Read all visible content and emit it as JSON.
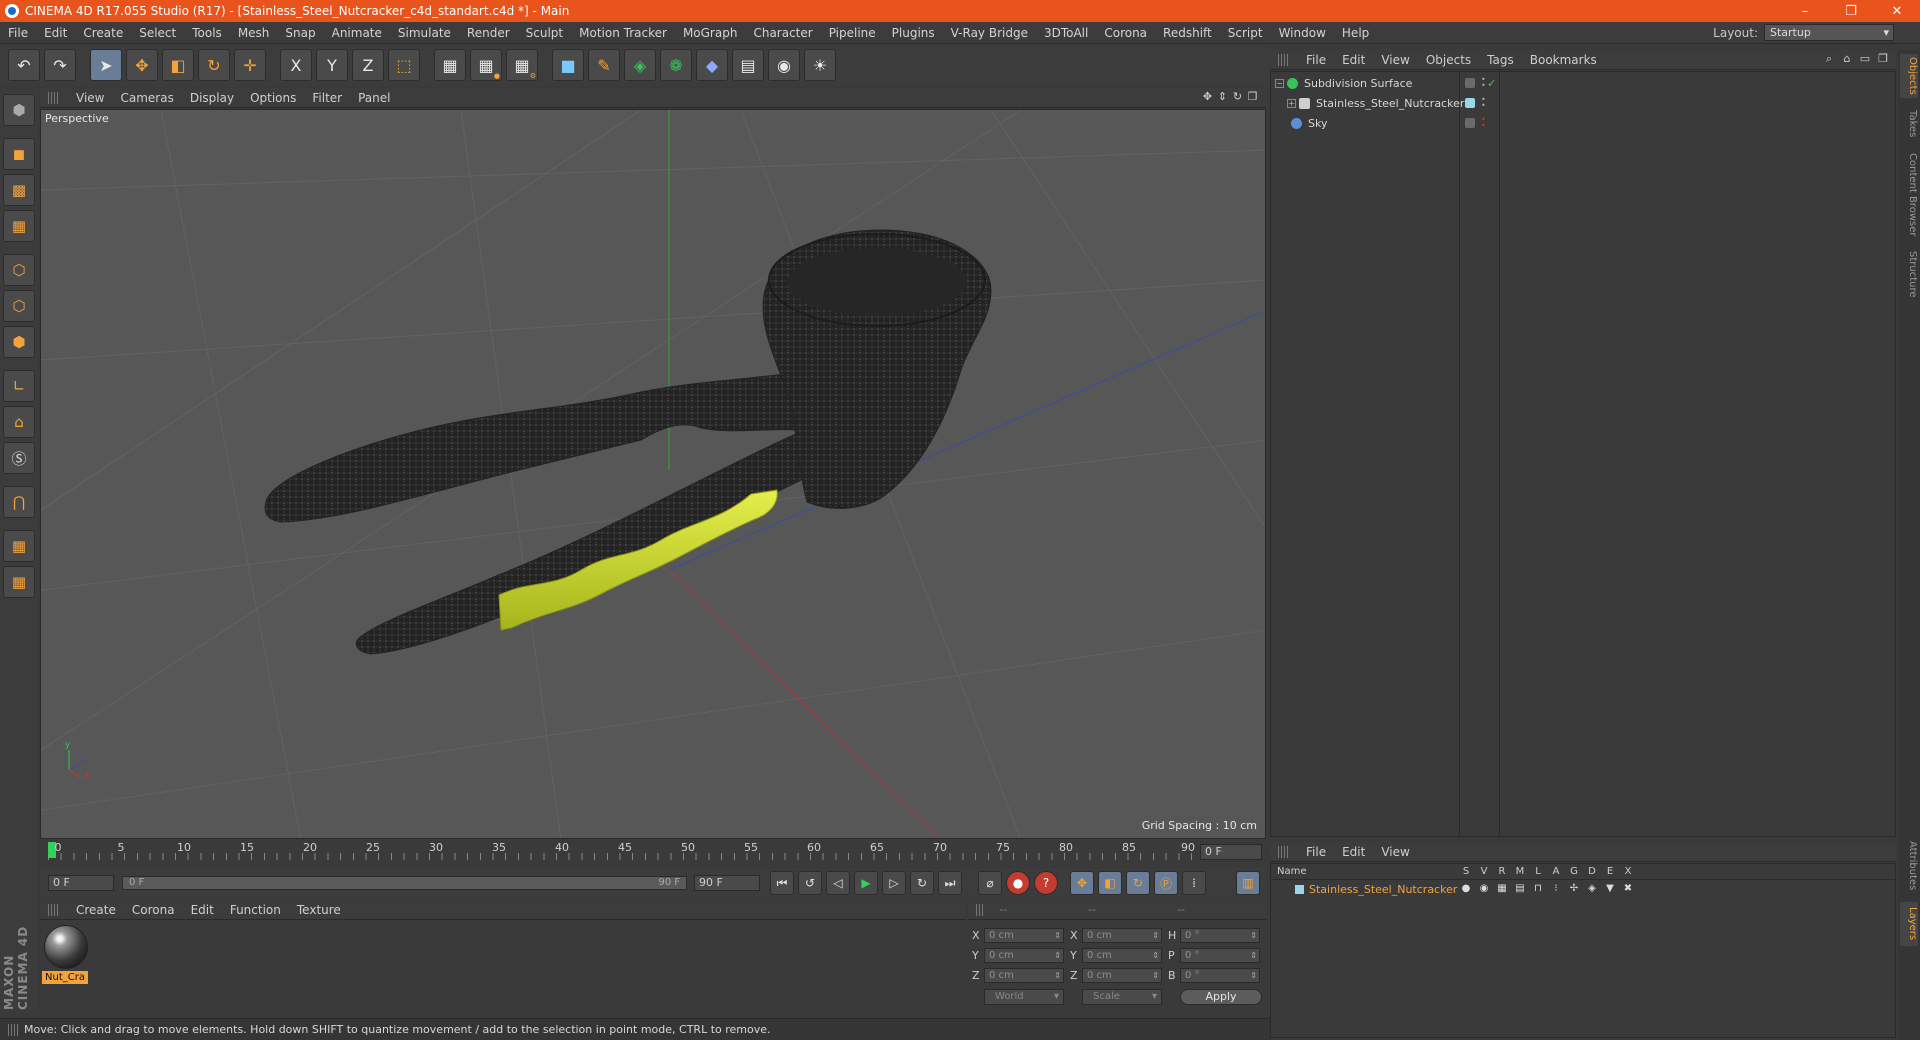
{
  "window": {
    "title": "CINEMA 4D R17.055 Studio (R17) - [Stainless_Steel_Nutcracker_c4d_standart.c4d *] - Main",
    "controls": [
      "–",
      "❐",
      "✕"
    ]
  },
  "menubar": {
    "items": [
      "File",
      "Edit",
      "Create",
      "Select",
      "Tools",
      "Mesh",
      "Snap",
      "Animate",
      "Simulate",
      "Render",
      "Sculpt",
      "Motion Tracker",
      "MoGraph",
      "Character",
      "Pipeline",
      "Plugins",
      "V-Ray Bridge",
      "3DToAll",
      "Corona",
      "Redshift",
      "Script",
      "Window",
      "Help"
    ],
    "layout_label": "Layout:",
    "layout_value": "Startup"
  },
  "toolbar": {
    "axis_x": "X",
    "axis_y": "Y",
    "axis_z": "Z"
  },
  "viewport": {
    "menu": [
      "View",
      "Cameras",
      "Display",
      "Options",
      "Filter",
      "Panel"
    ],
    "label": "Perspective",
    "grid_spacing": "Grid Spacing : 10 cm"
  },
  "timeline": {
    "ticks": [
      "0",
      "5",
      "10",
      "15",
      "20",
      "25",
      "30",
      "35",
      "40",
      "45",
      "50",
      "55",
      "60",
      "65",
      "70",
      "75",
      "80",
      "85",
      "90"
    ],
    "current_frame": "0 F",
    "start_frame": "0 F",
    "range_start": "0 F",
    "range_end": "90 F",
    "end_frame": "90 F"
  },
  "material_manager": {
    "menu": [
      "Create",
      "Corona",
      "Edit",
      "Function",
      "Texture"
    ],
    "materials": [
      {
        "name": "Nut_Cra"
      }
    ]
  },
  "coordinates": {
    "headers": [
      "--",
      "--",
      "--"
    ],
    "rows": [
      {
        "a1": "X",
        "v1": "0 cm",
        "a2": "X",
        "v2": "0 cm",
        "a3": "H",
        "v3": "0 °"
      },
      {
        "a1": "Y",
        "v1": "0 cm",
        "a2": "Y",
        "v2": "0 cm",
        "a3": "P",
        "v3": "0 °"
      },
      {
        "a1": "Z",
        "v1": "0 cm",
        "a2": "Z",
        "v2": "0 cm",
        "a3": "B",
        "v3": "0 °"
      }
    ],
    "space": "World",
    "mode": "Scale",
    "apply": "Apply"
  },
  "status": {
    "text": "Move: Click and drag to move elements. Hold down SHIFT to quantize movement / add to the selection in point mode, CTRL to remove."
  },
  "object_manager": {
    "menu": [
      "File",
      "Edit",
      "View",
      "Objects",
      "Tags",
      "Bookmarks"
    ],
    "objects": [
      {
        "name": "Subdivision Surface",
        "color": "#35c35a"
      },
      {
        "name": "Stainless_Steel_Nutcracker",
        "color": "#cfcfcf"
      },
      {
        "name": "Sky",
        "color": "#5a8fd6"
      }
    ]
  },
  "layer_manager": {
    "menu": [
      "File",
      "Edit",
      "View"
    ],
    "header": {
      "name": "Name",
      "flags": [
        "S",
        "V",
        "R",
        "M",
        "L",
        "A",
        "G",
        "D",
        "E",
        "X"
      ]
    },
    "layers": [
      {
        "name": "Stainless_Steel_Nutcracker",
        "color": "#9ad6e8"
      }
    ]
  },
  "right_tabs": [
    "Objects",
    "Takes",
    "Content Browser",
    "Structure",
    "Attributes",
    "Layers"
  ],
  "brand": "MAXON CINEMA 4D",
  "colors": {
    "title_bar": "#e8541c",
    "accent": "#f3a33a",
    "model": "#2a2a2a",
    "grip_handle": "#d4e22a"
  }
}
